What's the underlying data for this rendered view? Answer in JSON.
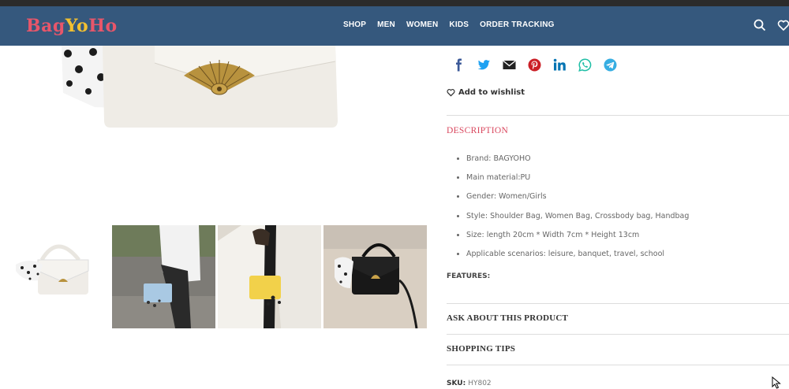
{
  "browser_strip": {
    "text": "…"
  },
  "header": {
    "logo": {
      "part1": "Bag",
      "part2": "Yo",
      "part3": "Ho"
    },
    "nav": [
      "SHOP",
      "MEN",
      "WOMEN",
      "KIDS",
      "ORDER TRACKING"
    ],
    "icons": [
      "search-icon",
      "heart-icon"
    ]
  },
  "product": {
    "share_icons": [
      {
        "name": "facebook-icon",
        "color": "#3b5998"
      },
      {
        "name": "twitter-icon",
        "color": "#1da1f2"
      },
      {
        "name": "email-icon",
        "color": "#222222"
      },
      {
        "name": "pinterest-icon",
        "color": "#cb2027"
      },
      {
        "name": "linkedin-icon",
        "color": "#0274b3"
      },
      {
        "name": "whatsapp-icon",
        "color": "#1ebea5"
      },
      {
        "name": "telegram-icon",
        "color": "#37aee2"
      }
    ],
    "wishlist_label": "Add to wishlist",
    "description_title": "DESCRIPTION",
    "description_items": [
      "Brand: BAGYOHO",
      "Main material:PU",
      "Gender: Women/Girls",
      "Style: Shoulder Bag, Women Bag, Crossbody bag, Handbag",
      "Size: length 20cm * Width 7cm * Height 13cm",
      "Applicable scenarios: leisure, banquet, travel, school"
    ],
    "features_label": "FEATURES:",
    "ask_label": "ASK ABOUT THIS PRODUCT",
    "shopping_tips_label": "SHOPPING TIPS",
    "sku_label": "SKU:",
    "sku_value": "HY802"
  },
  "colors": {
    "header_bg": "#35587d",
    "accent": "#d9475e"
  }
}
